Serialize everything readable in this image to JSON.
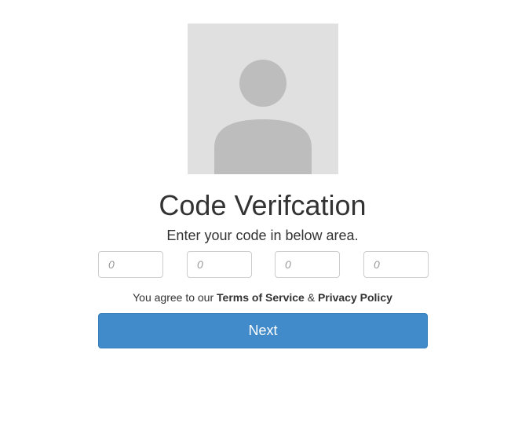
{
  "avatar": {
    "icon": "user-placeholder-icon"
  },
  "header": {
    "title": "Code Verifcation",
    "subtitle": "Enter your code in below area."
  },
  "code_inputs": [
    {
      "placeholder": "0",
      "value": ""
    },
    {
      "placeholder": "0",
      "value": ""
    },
    {
      "placeholder": "0",
      "value": ""
    },
    {
      "placeholder": "0",
      "value": ""
    }
  ],
  "agreement": {
    "prefix": "You agree to our",
    "terms_label": "Terms of Service",
    "separator": "&",
    "privacy_label": "Privacy Policy"
  },
  "actions": {
    "next_label": "Next"
  },
  "colors": {
    "primary_button": "#428bca",
    "avatar_bg": "#e0e0e0",
    "avatar_fg": "#bdbdbd",
    "text": "#333333"
  }
}
